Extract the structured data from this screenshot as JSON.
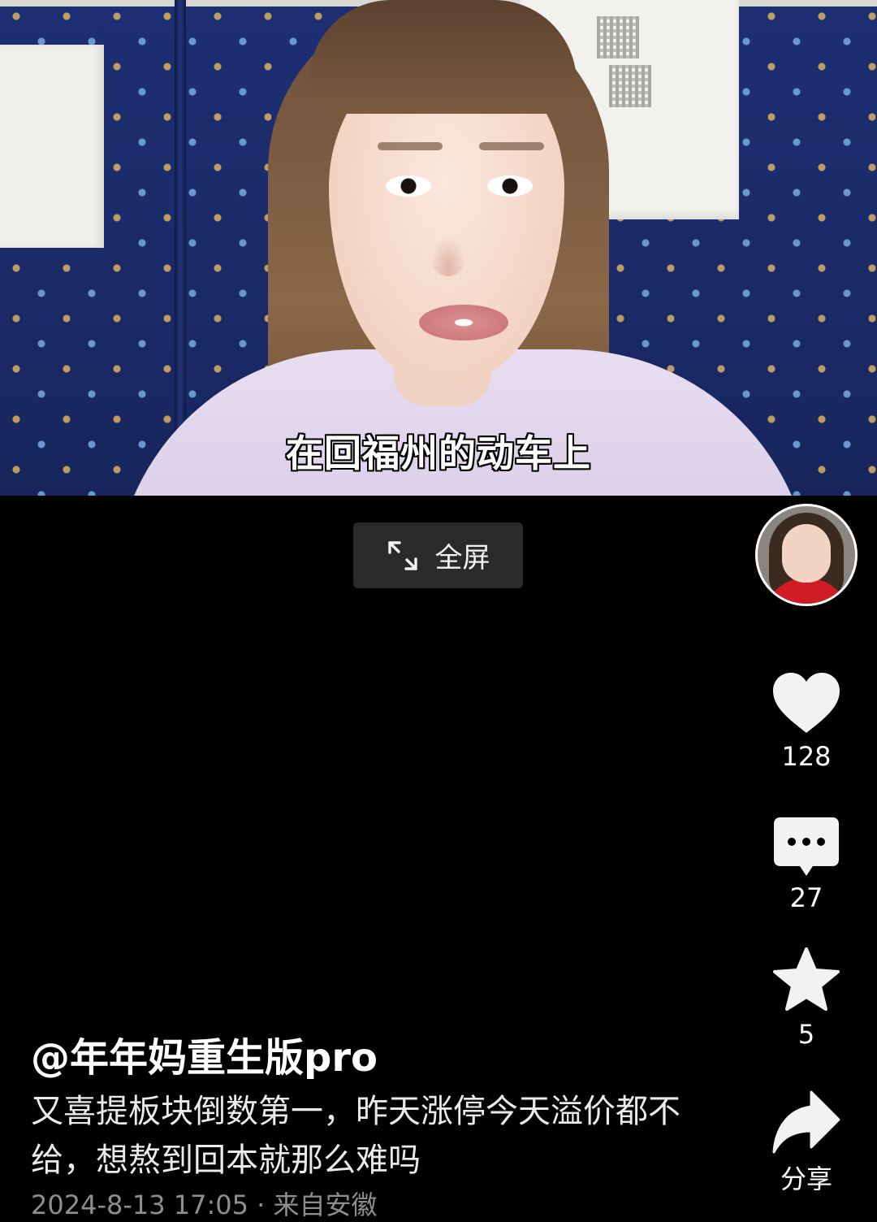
{
  "video": {
    "subtitle": "在回福州的动车上",
    "fullscreen_label": "全屏"
  },
  "rail": {
    "like_count": "128",
    "comment_count": "27",
    "favorite_count": "5",
    "share_label": "分享"
  },
  "post": {
    "author": "@年年妈重生版pro",
    "description": "又喜提板块倒数第一，昨天涨停今天溢价都不给，想熬到回本就那么难吗",
    "meta": "2024-8-13 17:05 · 来自安徽"
  },
  "colors": {
    "background": "#000000",
    "seat_blue": "#1d2f73",
    "fullscreen_button_bg": "#2a2a2a",
    "icon_color": "#f2f2f2"
  },
  "icons": {
    "fullscreen": "expand-arrows-icon",
    "like": "heart-icon",
    "comment": "speech-bubble-dots-icon",
    "favorite": "star-icon",
    "share": "share-arrow-icon"
  }
}
